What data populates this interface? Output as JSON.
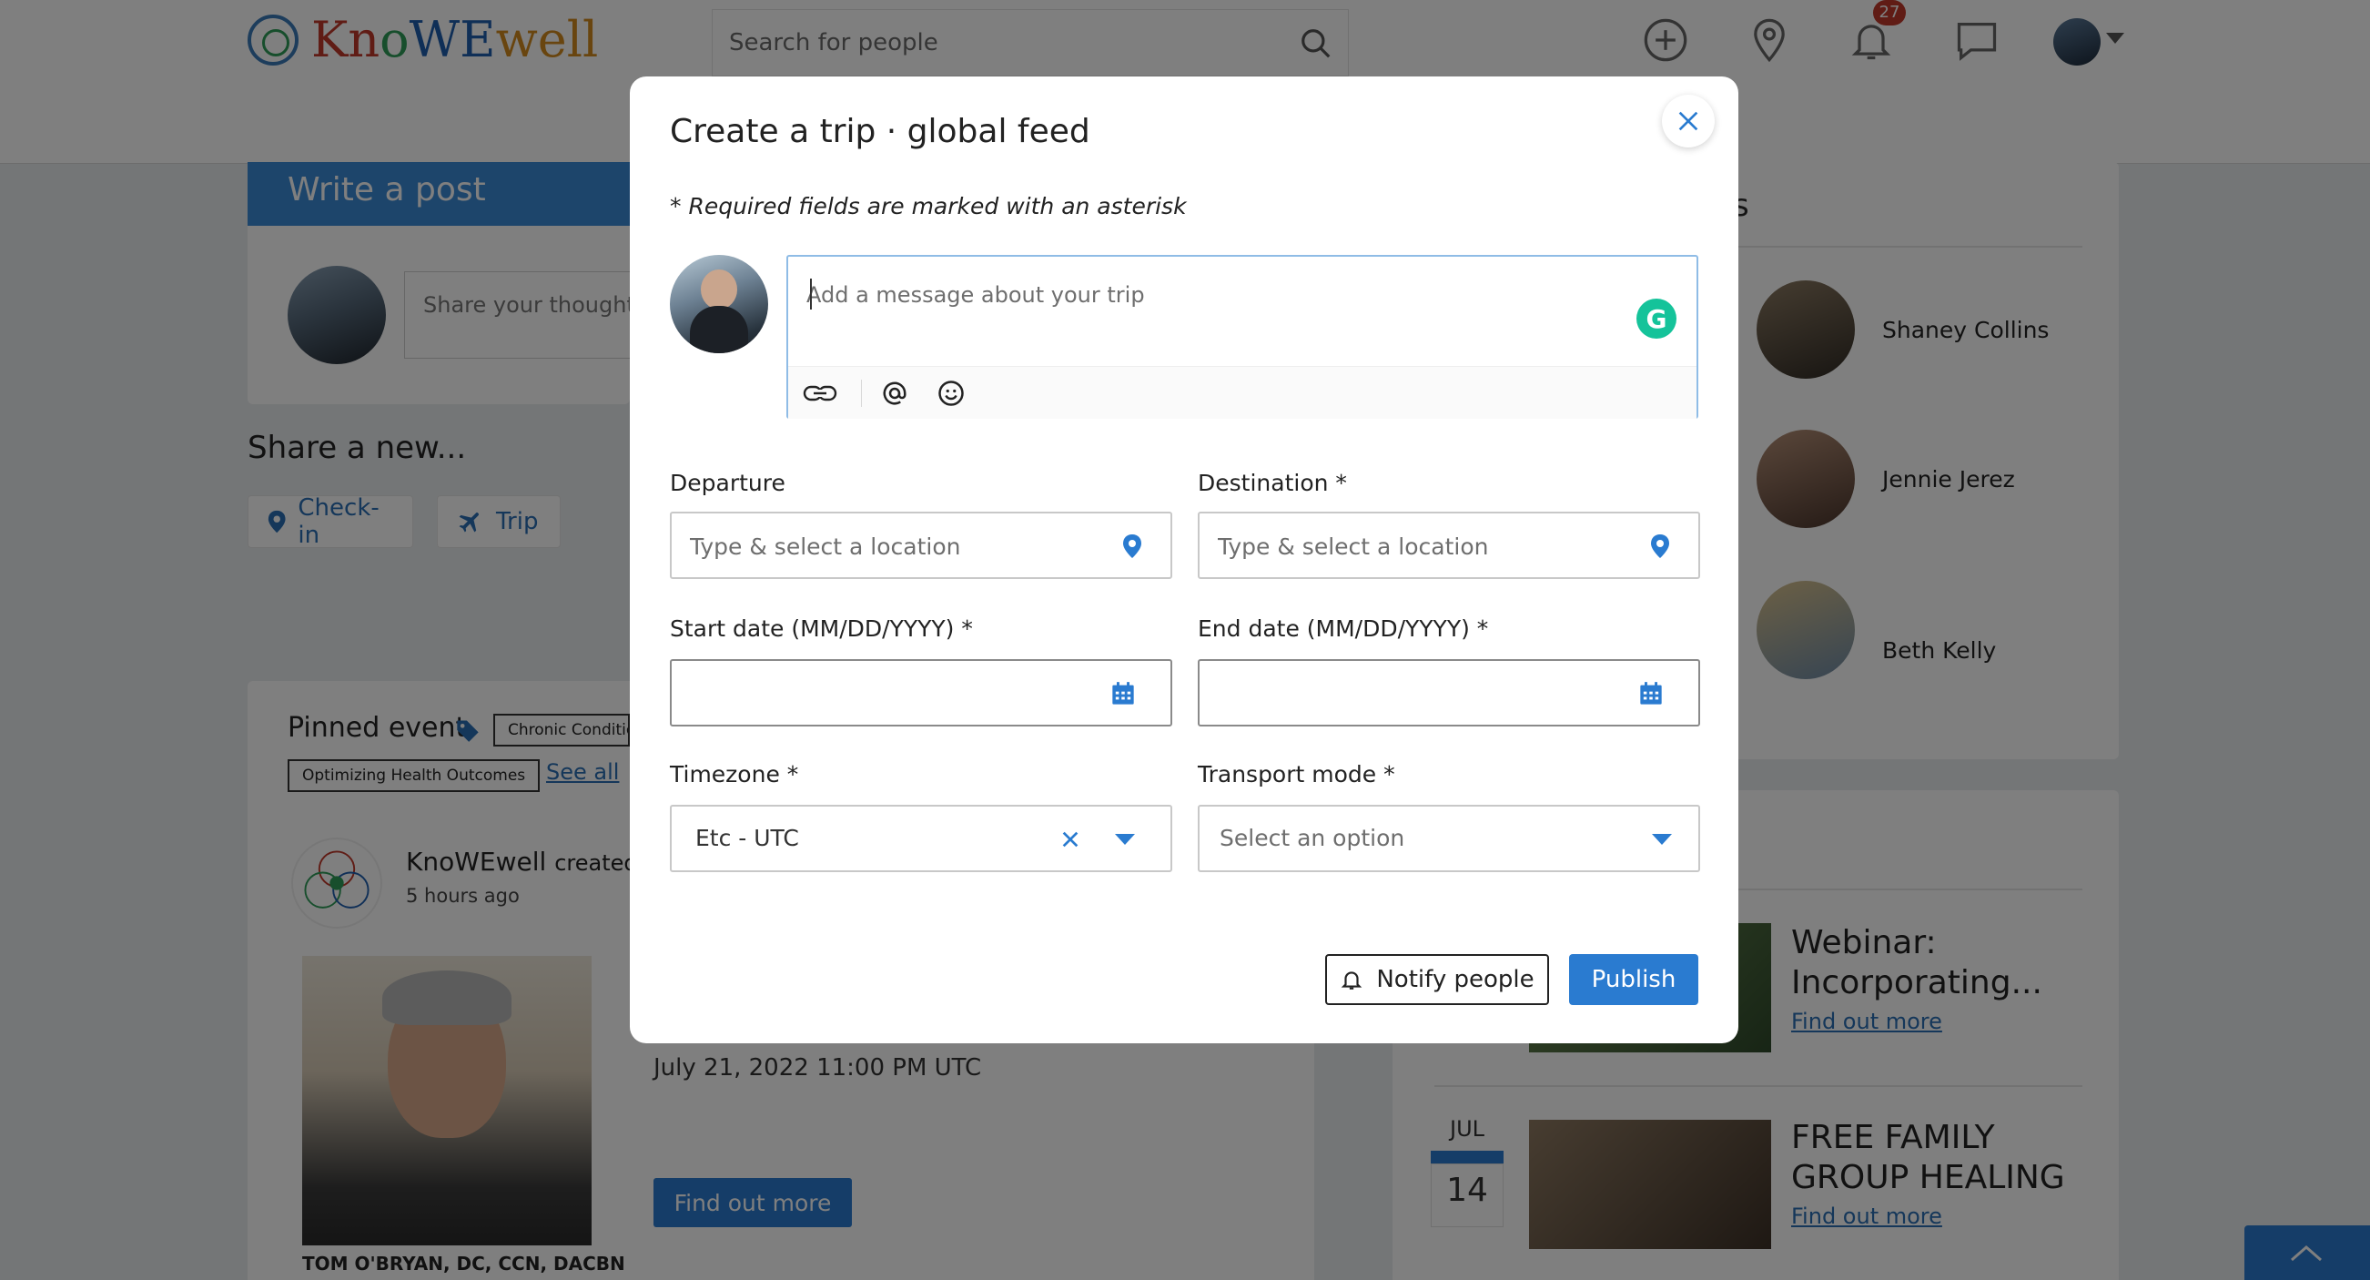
{
  "header": {
    "logo_text": "KnoWEwell",
    "search_placeholder": "Search for people",
    "notification_count": "27"
  },
  "feed": {
    "write_post_label": "Write a post",
    "share_placeholder": "Share your thoughts",
    "share_new_label": "Share a new...",
    "checkin_label": "Check-in",
    "trip_label": "Trip",
    "pinned_event_label": "Pinned event",
    "tags": [
      "Chronic Conditio",
      "Optimizing Health Outcomes"
    ],
    "see_all_label": "See all",
    "post_author": "KnoWEwell",
    "post_action": "created",
    "post_time": "5 hours ago",
    "speaker_caption": "TOM O'BRYAN, DC, CCN, DACBN",
    "event_datetime": "July 21, 2022 11:00 PM UTC",
    "find_out_more_button": "Find out more"
  },
  "sidebar": {
    "section_heading_fragment": "s",
    "people": [
      {
        "name": "Shaney Collins"
      },
      {
        "name": "Jennie Jerez"
      },
      {
        "name": "Beth Kelly"
      }
    ],
    "events": [
      {
        "title_line1": "Webinar:",
        "title_line2": "Incorporating...",
        "link": "Find out more"
      },
      {
        "month": "JUL",
        "day": "14",
        "title_line1": "FREE FAMILY",
        "title_line2": "GROUP HEALING",
        "link": "Find out more"
      }
    ]
  },
  "modal": {
    "title": "Create a trip · global feed",
    "required_note": "* Required fields are marked with an asterisk",
    "message_placeholder": "Add a message about your trip",
    "departure_label": "Departure",
    "departure_placeholder": "Type & select a location",
    "destination_label": "Destination *",
    "destination_placeholder": "Type & select a location",
    "start_date_label": "Start date (MM/DD/YYYY) *",
    "start_date_value": "",
    "end_date_label": "End date (MM/DD/YYYY) *",
    "end_date_value": "",
    "timezone_label": "Timezone *",
    "timezone_value": "Etc - UTC",
    "transport_label": "Transport mode *",
    "transport_placeholder": "Select an option",
    "notify_button": "Notify people",
    "publish_button": "Publish"
  },
  "colors": {
    "accent": "#2a7bd0",
    "input_focus_border": "#8fbce6",
    "badge": "#c0392b",
    "grammarly": "#15c39a"
  }
}
